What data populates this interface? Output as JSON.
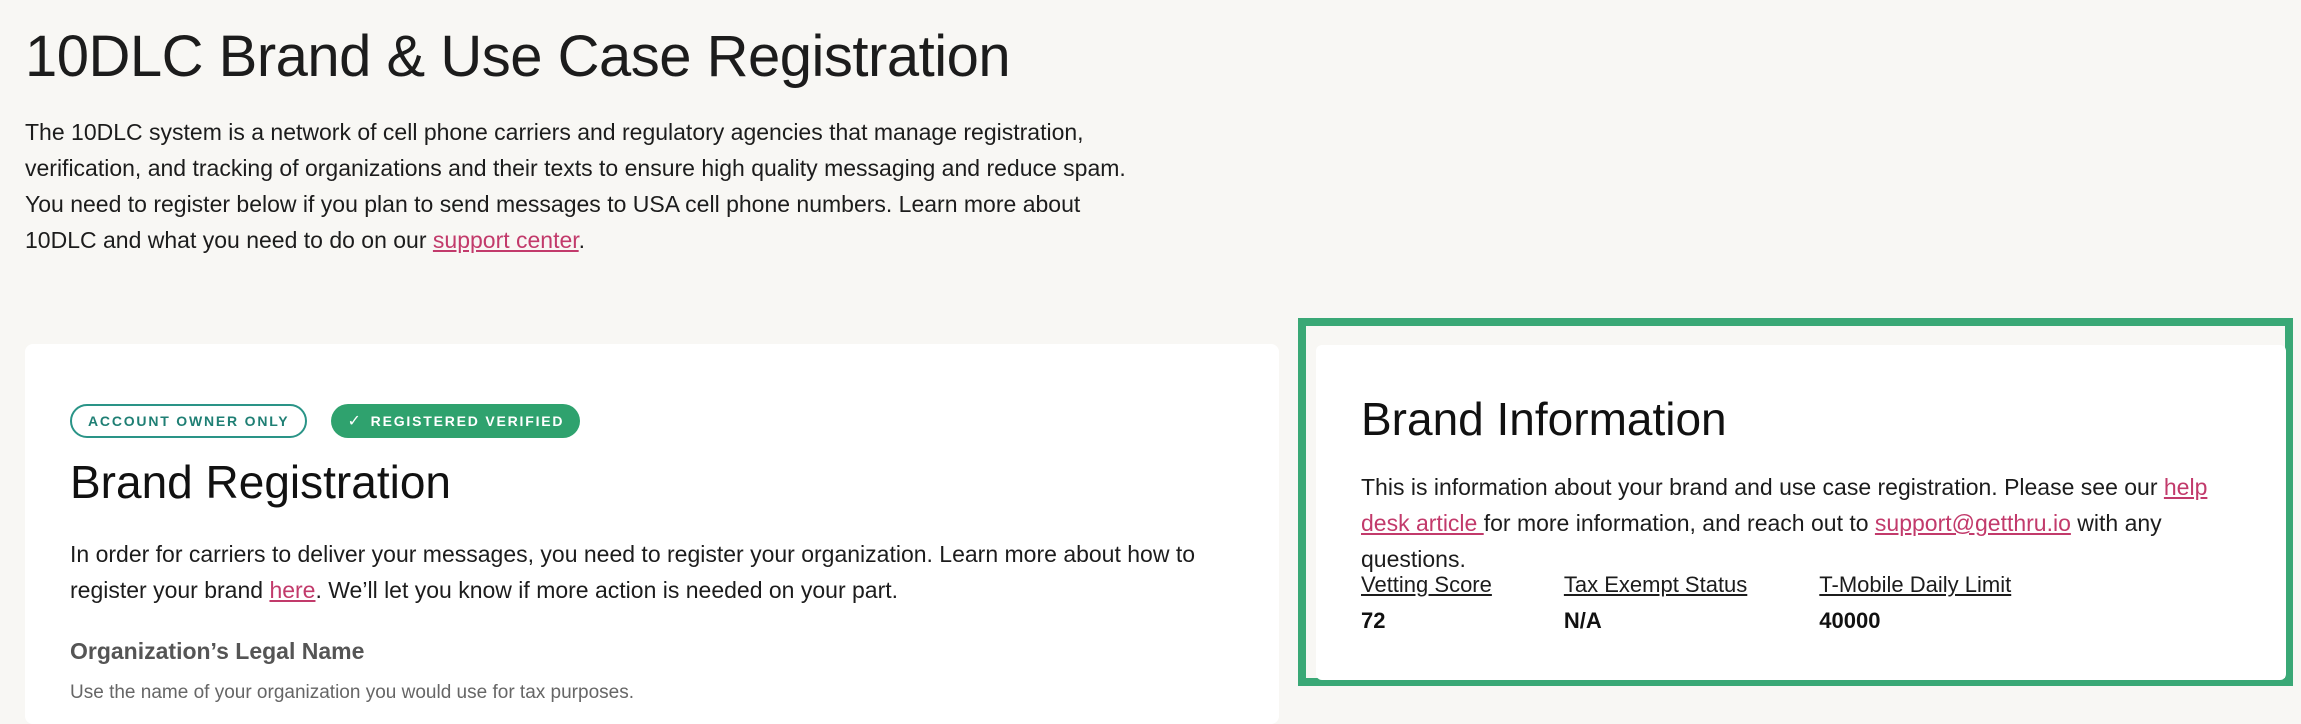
{
  "page": {
    "title": "10DLC Brand & Use Case Registration",
    "intro_text": "The 10DLC system is a network of cell phone carriers and regulatory agencies that manage registration, verification, and tracking of organizations and their texts to ensure high quality messaging and reduce spam. You need to register below if you plan to send messages to USA cell phone numbers. Learn more about 10DLC and what you need to do on our ",
    "intro_link": "support center",
    "intro_end": "."
  },
  "brand_registration": {
    "badge_owner": "ACCOUNT OWNER ONLY",
    "badge_verified_icon": "check-icon",
    "badge_verified": "REGISTERED VERIFIED",
    "title": "Brand Registration",
    "text_before": "In order for carriers to deliver your messages, you need to register your organization. Learn more about how to register your brand ",
    "link": "here",
    "text_after": ". We’ll let you know if more action is needed on your part.",
    "field_label": "Organization’s Legal Name",
    "field_help": "Use the name of your organization you would use for tax purposes."
  },
  "brand_information": {
    "title": "Brand Information",
    "text_before": "This is information about your brand and use case registration. Please see our ",
    "link_help": "help desk article ",
    "text_middle": "for more information, and reach out to ",
    "link_email": "support@getthru.io",
    "text_after": " with any questions.",
    "stats": [
      {
        "label": "Vetting Score",
        "value": "72"
      },
      {
        "label": "Tax Exempt Status",
        "value": "N/A"
      },
      {
        "label": "T-Mobile Daily Limit",
        "value": "40000"
      }
    ]
  },
  "colors": {
    "background": "#f8f7f4",
    "link": "#c23a6b",
    "highlight_border": "#3aa876",
    "verified_badge": "#2fa26e",
    "owner_badge": "#2a9487"
  }
}
